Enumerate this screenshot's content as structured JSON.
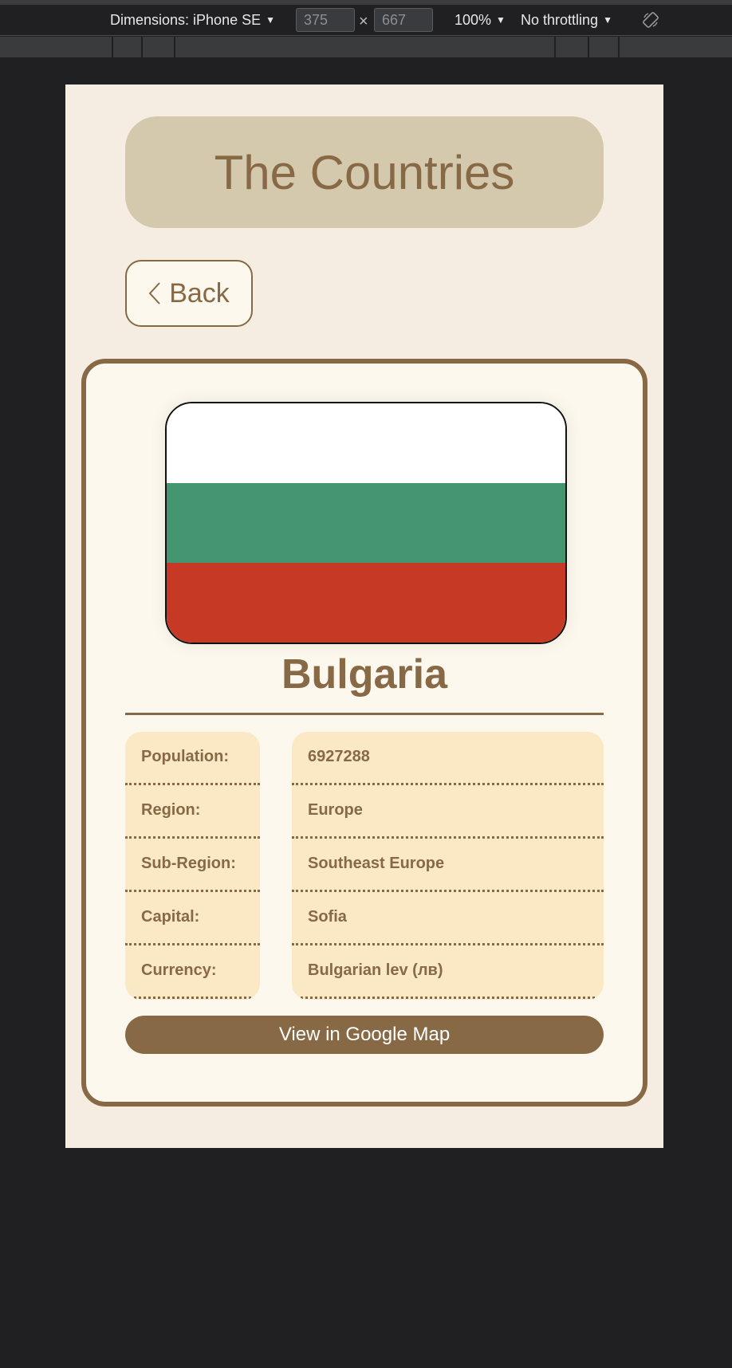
{
  "devtools": {
    "dimensions_label": "Dimensions: iPhone SE",
    "width_value": "375",
    "height_value": "667",
    "separator": "×",
    "zoom": "100%",
    "throttling": "No throttling"
  },
  "app": {
    "title": "The Countries",
    "back_label": "Back"
  },
  "country": {
    "name": "Bulgaria",
    "flag_colors": [
      "#ffffff",
      "#449570",
      "#c63925"
    ],
    "details": [
      {
        "label": "Population:",
        "value": "6927288"
      },
      {
        "label": "Region:",
        "value": "Europe"
      },
      {
        "label": "Sub-Region:",
        "value": "Southeast Europe"
      },
      {
        "label": "Capital:",
        "value": "Sofia"
      },
      {
        "label": "Currency:",
        "value": "Bulgarian lev (лв)"
      }
    ],
    "map_button_label": "View in Google Map"
  },
  "colors": {
    "accent": "#876946",
    "page_bg": "#f5ede1",
    "header_bg": "#d4c9ad",
    "info_bg": "#fbe9c6"
  }
}
